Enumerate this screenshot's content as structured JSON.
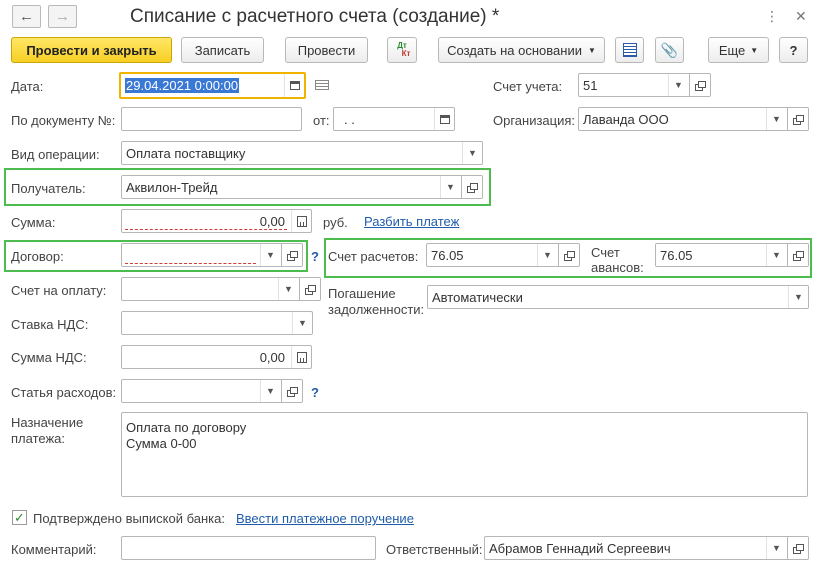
{
  "window": {
    "title": "Списание с расчетного счета (создание) *"
  },
  "toolbar": {
    "post_close": "Провести и закрыть",
    "save": "Записать",
    "post": "Провести",
    "dtkt": "Дт",
    "dtkt2": "Кт",
    "create_based": "Создать на основании",
    "more": "Еще",
    "help": "?"
  },
  "form": {
    "date_label": "Дата:",
    "date_value": "29.04.2021  0:00:00",
    "account_label": "Счет учета:",
    "account_value": "51",
    "doc_no_label": "По документу №:",
    "doc_no_value": "",
    "from_label": "от:",
    "from_value": " .  .",
    "org_label": "Организация:",
    "org_value": "Лаванда ООО",
    "op_type_label": "Вид операции:",
    "op_type_value": "Оплата поставщику",
    "recipient_label": "Получатель:",
    "recipient_value": "Аквилон-Трейд",
    "sum_label": "Сумма:",
    "sum_value": "0,00",
    "currency": "руб.",
    "split_link": "Разбить платеж",
    "contract_label": "Договор:",
    "contract_value": "",
    "settle_label": "Счет расчетов:",
    "settle_value": "76.05",
    "advance_label_1": "Счет",
    "advance_label_2": "авансов:",
    "advance_value": "76.05",
    "invoice_label": "Счет на оплату:",
    "invoice_value": "",
    "repay_label_1": "Погашение",
    "repay_label_2": "задолженности:",
    "repay_value": "Автоматически",
    "vat_rate_label": "Ставка НДС:",
    "vat_rate_value": "",
    "vat_sum_label": "Сумма НДС:",
    "vat_sum_value": "0,00",
    "expense_label": "Статья расходов:",
    "expense_value": "",
    "purpose_label_1": "Назначение",
    "purpose_label_2": "платежа:",
    "purpose_line_1": "Оплата по договору",
    "purpose_line_2": "Сумма 0-00",
    "confirmed_label": "Подтверждено выпиской банка:",
    "enter_order_link": "Ввести платежное поручение",
    "comment_label": "Комментарий:",
    "comment_value": "",
    "responsible_label": "Ответственный:",
    "responsible_value": "Абрамов Геннадий Сергеевич",
    "qmark": "?"
  },
  "colors": {
    "primary_button": "#f7cf24",
    "highlight_frame": "#4dbb4d",
    "link": "#1f5dab",
    "date_focus": "#f0b400"
  }
}
